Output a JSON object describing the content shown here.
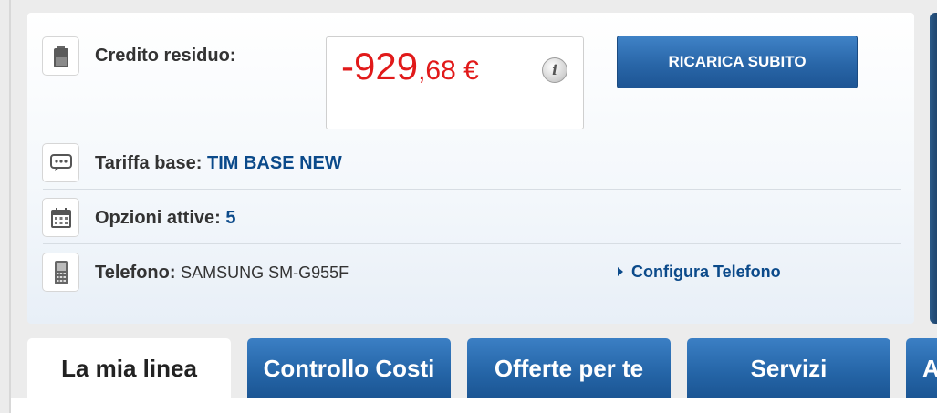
{
  "credit": {
    "label": "Credito residuo:",
    "amount_int": "-929",
    "amount_dec": ",68 €",
    "info_icon": "i"
  },
  "recharge_button": "RICARICA SUBITO",
  "tariff": {
    "label": "Tariffa base: ",
    "value": "TIM BASE NEW"
  },
  "options": {
    "label": "Opzioni attive: ",
    "value": "5"
  },
  "phone": {
    "label": "Telefono: ",
    "value": "SAMSUNG SM-G955F",
    "configure_link": "Configura Telefono"
  },
  "tabs": [
    {
      "label": "La mia linea",
      "active": true
    },
    {
      "label": "Controllo Costi",
      "active": false
    },
    {
      "label": "Offerte per te",
      "active": false
    },
    {
      "label": "Servizi",
      "active": false
    },
    {
      "label": "A",
      "active": false
    }
  ],
  "colors": {
    "credit_red": "#e11a1a",
    "link_blue": "#0b4a8a",
    "button_blue": "#2966a8"
  },
  "icons": {
    "credit": "battery-icon",
    "tariff": "speech-bubble-icon",
    "options": "calendar-icon",
    "phone": "mobile-phone-icon"
  }
}
